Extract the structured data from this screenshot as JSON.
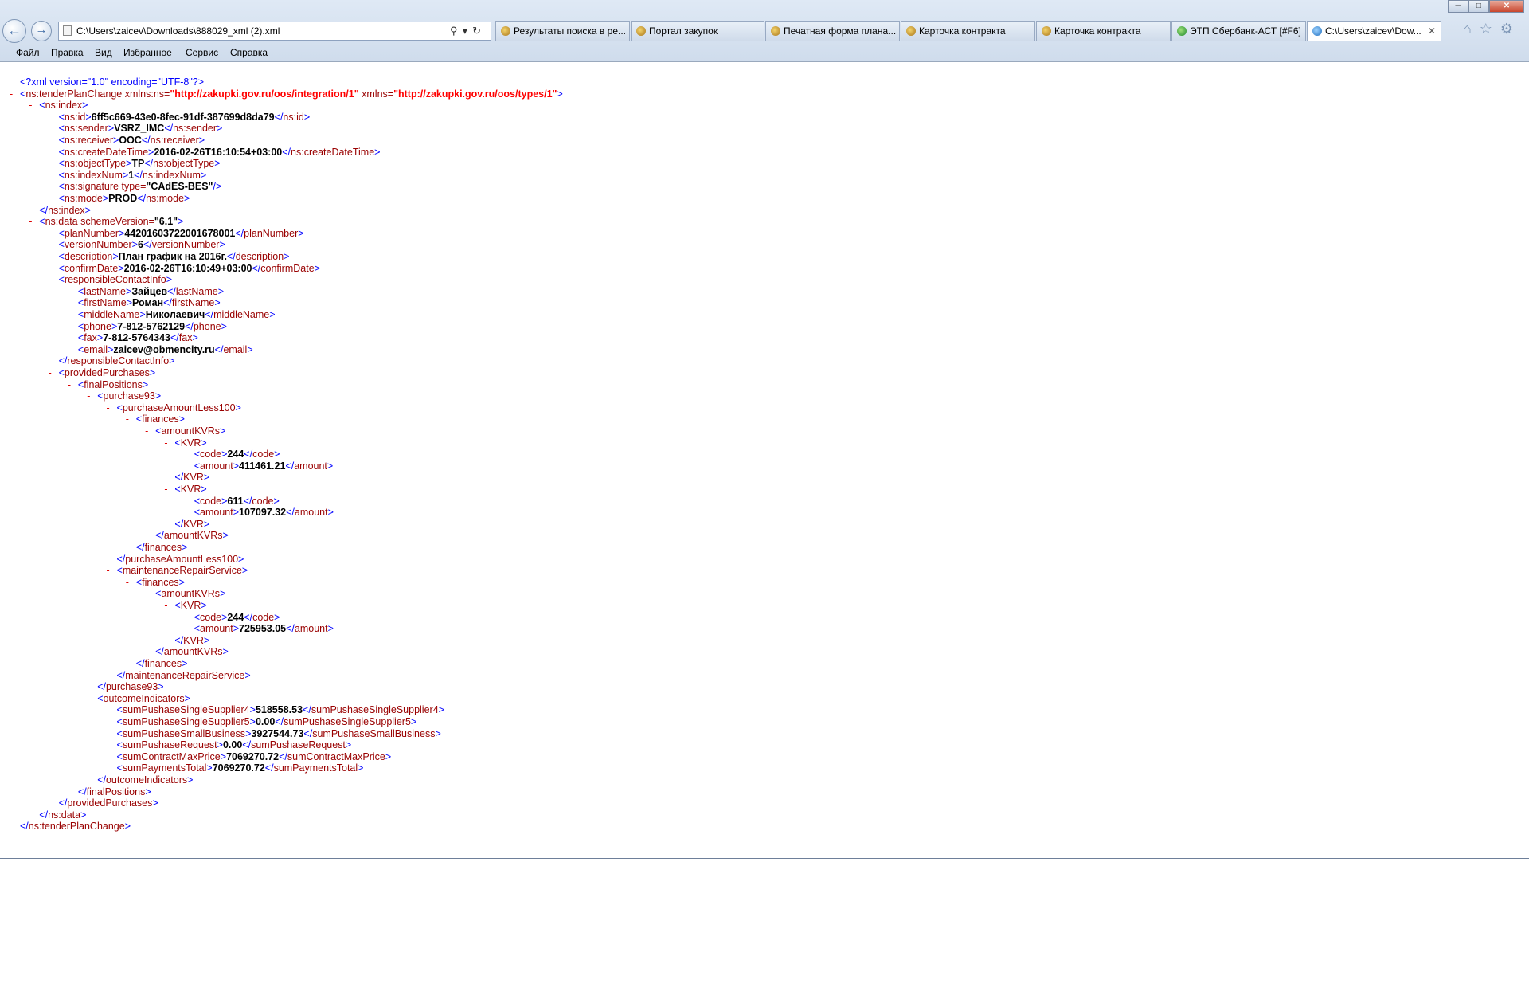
{
  "browser": {
    "address": "C:\\Users\\zaicev\\Downloads\\888029_xml (2).xml",
    "tabs": [
      "Результаты поиска в ре...",
      "Портал закупок",
      "Печатная форма плана...",
      "Карточка контракта",
      "Карточка контракта",
      "ЭТП Сбербанк-АСТ [#F6]",
      "C:\\Users\\zaicev\\Dow..."
    ],
    "menu": [
      "Файл",
      "Правка",
      "Вид",
      "Избранное",
      "Сервис",
      "Справка"
    ]
  },
  "xml": {
    "pi": "<?xml version=\"1.0\" encoding=\"UTF-8\"?>",
    "root_tag": "ns:tenderPlanChange",
    "root_attr1": "xmlns:ns",
    "root_val1": "http://zakupki.gov.ru/oos/integration/1",
    "root_attr2": "xmlns",
    "root_val2": "http://zakupki.gov.ru/oos/types/1",
    "index": {
      "id": "6ff5c669-43e0-8fec-91df-387699d8da79",
      "sender": "VSRZ_IMC",
      "receiver": "OOC",
      "createDateTime": "2016-02-26T16:10:54+03:00",
      "objectType": "TP",
      "indexNum": "1",
      "signature_type": "CAdES-BES",
      "mode": "PROD"
    },
    "data": {
      "schemeVersion": "6.1",
      "planNumber": "44201603722001678001",
      "versionNumber": "6",
      "description": "План график на 2016г.",
      "confirmDate": "2016-02-26T16:10:49+03:00",
      "contact": {
        "lastName": "Зайцев",
        "firstName": "Роман",
        "middleName": "Николаевич",
        "phone": "7-812-5762129",
        "fax": "7-812-5764343",
        "email": "zaicev@obmencity.ru"
      },
      "less100": [
        {
          "code": "244",
          "amount": "411461.21"
        },
        {
          "code": "611",
          "amount": "107097.32"
        }
      ],
      "repair": [
        {
          "code": "244",
          "amount": "725953.05"
        }
      ],
      "outcome": {
        "sumPushaseSingleSupplier4": "518558.53",
        "sumPushaseSingleSupplier5": "0.00",
        "sumPushaseSmallBusiness": "3927544.73",
        "sumPushaseRequest": "0.00",
        "sumContractMaxPrice": "7069270.72",
        "sumPaymentsTotal": "7069270.72"
      }
    }
  }
}
